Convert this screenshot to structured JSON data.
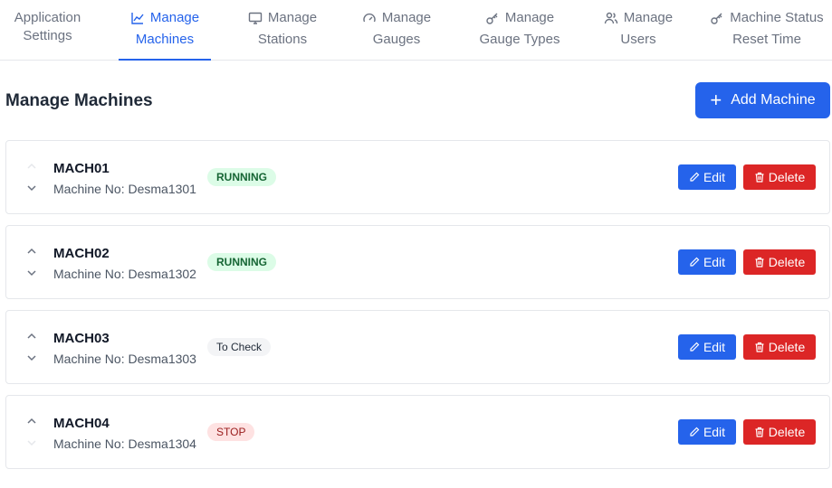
{
  "tabs": [
    {
      "line1": "Application",
      "line2": "Settings",
      "icon": "none"
    },
    {
      "line1": "Manage",
      "line2": "Machines",
      "icon": "chart-icon",
      "active": true
    },
    {
      "line1": "Manage",
      "line2": "Stations",
      "icon": "monitor-icon"
    },
    {
      "line1": "Manage",
      "line2": "Gauges",
      "icon": "gauge-icon"
    },
    {
      "line1": "Manage",
      "line2": "Gauge Types",
      "icon": "key-icon"
    },
    {
      "line1": "Manage",
      "line2": "Users",
      "icon": "users-icon"
    },
    {
      "line1": "Machine Status",
      "line2": "Reset Time",
      "icon": "key-icon"
    }
  ],
  "page": {
    "title": "Manage Machines",
    "add_button": "Add Machine"
  },
  "machines": [
    {
      "name": "MACH01",
      "machine_no": "Machine No: Desma1301",
      "status": "RUNNING",
      "edit": "Edit",
      "delete": "Delete"
    },
    {
      "name": "MACH02",
      "machine_no": "Machine No: Desma1302",
      "status": "RUNNING",
      "edit": "Edit",
      "delete": "Delete"
    },
    {
      "name": "MACH03",
      "machine_no": "Machine No: Desma1303",
      "status": "To Check",
      "edit": "Edit",
      "delete": "Delete"
    },
    {
      "name": "MACH04",
      "machine_no": "Machine No: Desma1304",
      "status": "STOP",
      "edit": "Edit",
      "delete": "Delete"
    }
  ],
  "colors": {
    "primary": "#2563eb",
    "danger": "#dc2626",
    "running_bg": "#dcfce7",
    "stop_bg": "#fee2e2"
  }
}
